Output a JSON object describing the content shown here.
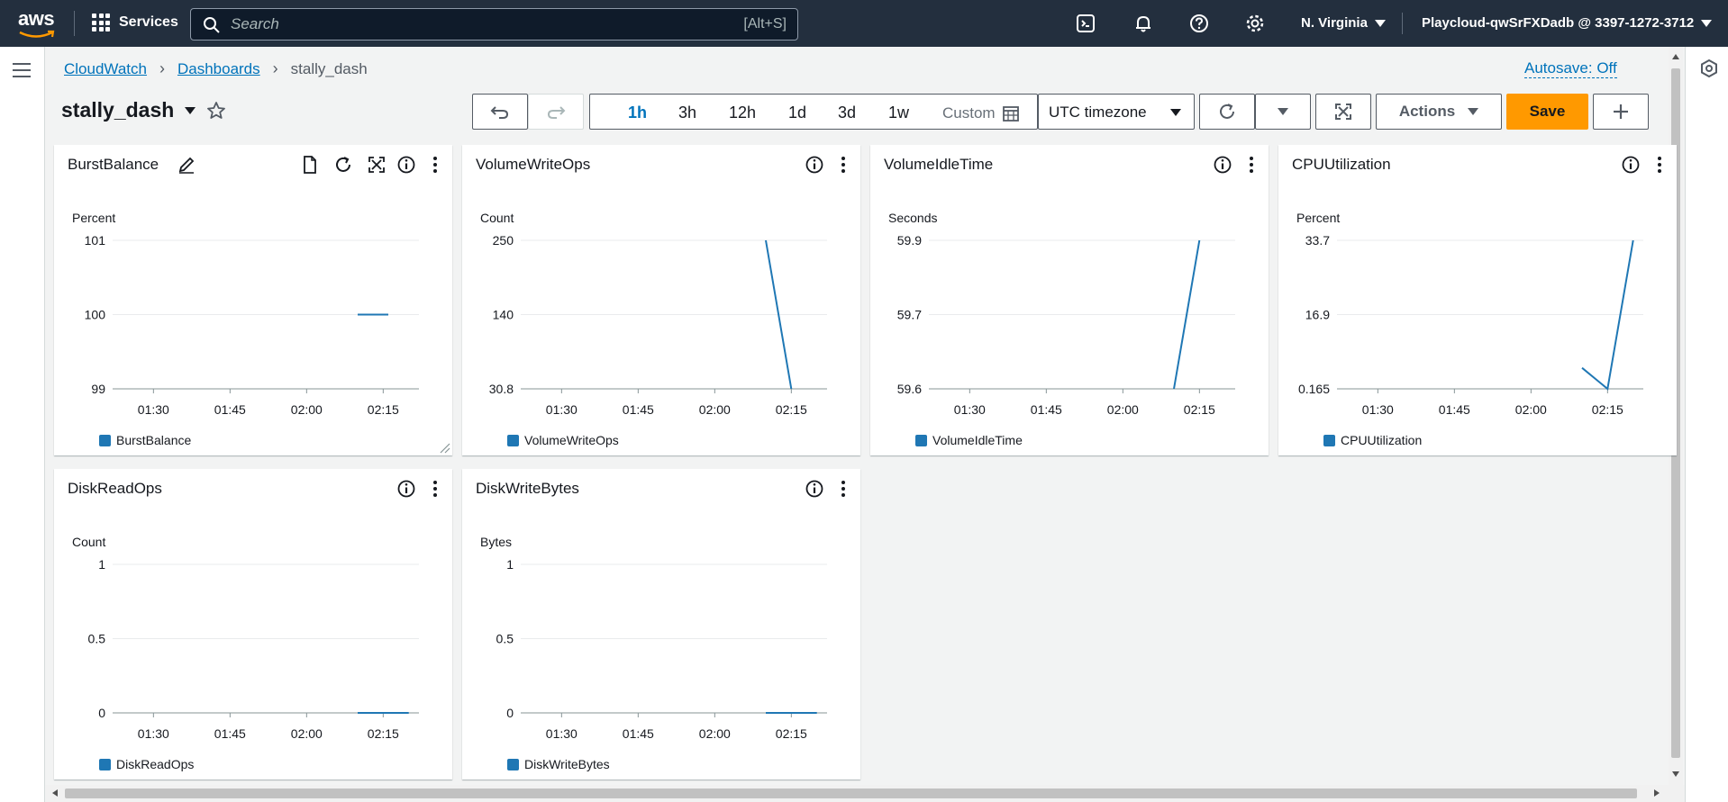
{
  "topnav": {
    "logo_text": "aws",
    "services_label": "Services",
    "search_placeholder": "Search",
    "search_shortcut": "[Alt+S]",
    "region": "N. Virginia",
    "account": "Playcloud-qwSrFXDadb @ 3397-1272-3712"
  },
  "breadcrumb": {
    "items": [
      "CloudWatch",
      "Dashboards"
    ],
    "current": "stally_dash"
  },
  "autosave_label": "Autosave: Off",
  "dashboard_title": "stally_dash",
  "timerange": {
    "options": [
      "1h",
      "3h",
      "12h",
      "1d",
      "3d",
      "1w"
    ],
    "active": "1h",
    "custom_label": "Custom"
  },
  "timezone_label": "UTC timezone",
  "actions_label": "Actions",
  "save_label": "Save",
  "colors": {
    "series": "#1f77b4",
    "accent": "#ff9900",
    "link": "#0073bb",
    "nav": "#232f3e"
  },
  "widgets": [
    {
      "title": "BurstBalance",
      "unit": "Percent",
      "legend": "BurstBalance",
      "yticks": [
        "101",
        "100",
        "99"
      ],
      "xticks": [
        "01:30",
        "01:45",
        "02:00",
        "02:15"
      ],
      "series": [
        {
          "t": "02:10",
          "v": 100
        },
        {
          "t": "02:16",
          "v": 100
        }
      ]
    },
    {
      "title": "VolumeWriteOps",
      "unit": "Count",
      "legend": "VolumeWriteOps",
      "yticks": [
        "250",
        "140",
        "30.8"
      ],
      "xticks": [
        "01:30",
        "01:45",
        "02:00",
        "02:15"
      ],
      "series": [
        {
          "t": "02:10",
          "v": 250
        },
        {
          "t": "02:15",
          "v": 30.8
        }
      ]
    },
    {
      "title": "VolumeIdleTime",
      "unit": "Seconds",
      "legend": "VolumeIdleTime",
      "yticks": [
        "59.9",
        "59.7",
        "59.6"
      ],
      "xticks": [
        "01:30",
        "01:45",
        "02:00",
        "02:15"
      ],
      "series": [
        {
          "t": "02:10",
          "v": 59.6
        },
        {
          "t": "02:15",
          "v": 59.9
        }
      ]
    },
    {
      "title": "CPUUtilization",
      "unit": "Percent",
      "legend": "CPUUtilization",
      "yticks": [
        "33.7",
        "16.9",
        "0.165"
      ],
      "xticks": [
        "01:30",
        "01:45",
        "02:00",
        "02:15"
      ],
      "series": [
        {
          "t": "02:10",
          "v": 4.9
        },
        {
          "t": "02:15",
          "v": 0.165
        },
        {
          "t": "02:20",
          "v": 33.7
        }
      ]
    },
    {
      "title": "DiskReadOps",
      "unit": "Count",
      "legend": "DiskReadOps",
      "yticks": [
        "1",
        "0.5",
        "0"
      ],
      "xticks": [
        "01:30",
        "01:45",
        "02:00",
        "02:15"
      ],
      "series": [
        {
          "t": "02:10",
          "v": 0
        },
        {
          "t": "02:20",
          "v": 0
        }
      ]
    },
    {
      "title": "DiskWriteBytes",
      "unit": "Bytes",
      "legend": "DiskWriteBytes",
      "yticks": [
        "1",
        "0.5",
        "0"
      ],
      "xticks": [
        "01:30",
        "01:45",
        "02:00",
        "02:15"
      ],
      "series": [
        {
          "t": "02:10",
          "v": 0
        },
        {
          "t": "02:20",
          "v": 0
        }
      ]
    }
  ]
}
